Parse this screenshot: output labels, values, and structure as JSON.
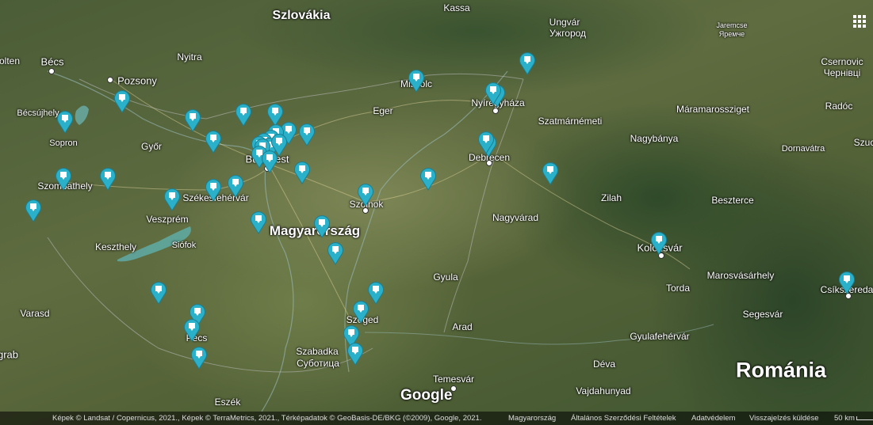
{
  "map": {
    "country_labels": {
      "slovakia": "Szlovákia",
      "hungary": "Magyarország",
      "romania": "Románia"
    },
    "cities": {
      "kassa": "Kassa",
      "ungvar": "Ungvár",
      "ungvar_cyr": "Ужгород",
      "jaremcse": "Jaremcse",
      "jaremcse_cyr": "Яремче",
      "csernovic": "Csernovic",
      "csernovic_cyr": "Чернівці",
      "becs": "Bécs",
      "pozsony": "Pozsony",
      "nyitra": "Nyitra",
      "olten": "olten",
      "miskolc": "Miskolc",
      "eger": "Eger",
      "nyiregyhaza": "Nyíregyháza",
      "maramarossziget": "Máramarossziget",
      "radoc": "Radóc",
      "szuc": "Szuc",
      "becsujhely": "Bécsújhely",
      "sopron": "Sopron",
      "gyor": "Győr",
      "budapest": "Budapest",
      "szatmarnemeti": "Szatmárnémeti",
      "nagybanya": "Nagybánya",
      "debrecen": "Debrecen",
      "dornavatra": "Dornavátra",
      "szombathely": "Szombathely",
      "szekesfehervar": "Székesfehérvár",
      "szolnok": "Szolnok",
      "zilah": "Zilah",
      "beszterce": "Beszterce",
      "veszprem": "Veszprém",
      "nagyvarad": "Nagyvárad",
      "keszthely": "Keszthely",
      "siofok": "Siófok",
      "kolozsvar": "Kolozsvár",
      "gyula": "Gyula",
      "marosvasarhely": "Marosvásárhely",
      "torda": "Torda",
      "varasd": "Varasd",
      "segesvar": "Segesvár",
      "csikszereda": "Csíkszereda",
      "szeged": "Szeged",
      "arad": "Arad",
      "pecs": "Pécs",
      "gyulafehervar": "Gyulafehérvár",
      "zagrab": "grab",
      "szabadka": "Szabadka",
      "szabadka_cyr": "Суботица",
      "deva": "Déva",
      "temesvar": "Temesvár",
      "vajdahunyad": "Vajdahunyad",
      "eszek": "Eszék"
    },
    "pin_count": 46,
    "colors": {
      "pin": "#2bb0c9",
      "pin_stroke": "#1a7f92",
      "lake": "#5fa7a0"
    }
  },
  "controls": {
    "grid_icon": "grid-dots-icon"
  },
  "google_logo": "Google",
  "footer": {
    "imagery": "Képek © Landsat / Copernicus, 2021., Képek © TerraMetrics, 2021., Térképadatok © GeoBasis-DE/BKG (©2009), Google, 2021.",
    "region": "Magyarország",
    "terms": "Általános Szerződési Feltételek",
    "privacy": "Adatvédelem",
    "feedback": "Visszajelzés küldése",
    "scale": "50 km"
  }
}
